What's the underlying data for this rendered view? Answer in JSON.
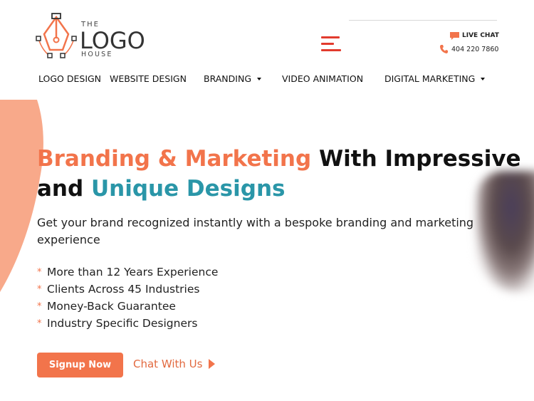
{
  "logo": {
    "the": "THE",
    "word": "LOGO",
    "house": "HOUSE",
    "icon": "pen-nib-icon"
  },
  "header": {
    "live_chat": "LIVE CHAT",
    "phone": "404 220 7860",
    "menu_icon": "hamburger-menu-icon"
  },
  "nav": {
    "items": [
      {
        "label": "LOGO DESIGN",
        "dropdown": false
      },
      {
        "label": "WEBSITE DESIGN",
        "dropdown": false
      },
      {
        "label": "BRANDING",
        "dropdown": true
      },
      {
        "label": "VIDEO ANIMATION",
        "dropdown": false
      },
      {
        "label": "DIGITAL MARKETING",
        "dropdown": true
      }
    ]
  },
  "hero": {
    "headline_orange": "Branding & Marketing",
    "headline_black_1": " With Impressive",
    "headline_black_2": "and ",
    "headline_teal": "Unique Designs",
    "subtext": "Get your brand recognized instantly with a bespoke branding and marketing experience",
    "features": [
      "More than 12 Years Experience",
      "Clients Across 45 Industries",
      "Money-Back Guarantee",
      "Industry Specific Designers"
    ],
    "signup_label": "Signup Now",
    "chat_label": "Chat With Us"
  },
  "colors": {
    "accent_orange": "#f2744b",
    "accent_teal": "#2a96a8",
    "menu_red": "#e23b2e",
    "blob": "#f8a98a"
  }
}
